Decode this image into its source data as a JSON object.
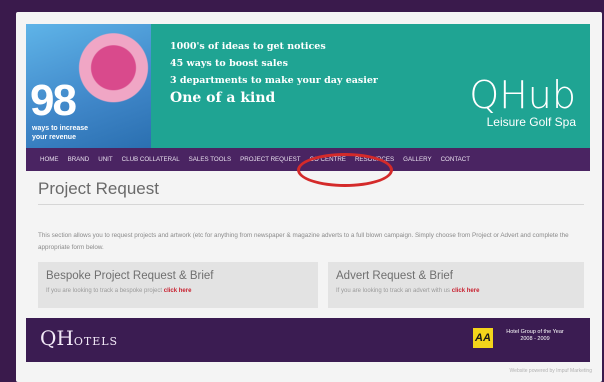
{
  "header": {
    "hero_number": "98",
    "hero_subtitle_line1": "ways to increase",
    "hero_subtitle_line2": "your revenue",
    "line1": "1000's of ideas to get notices",
    "line2": "45 ways to boost sales",
    "line3": "3 departments to make your day easier",
    "line4": "One of a kind",
    "brand_logo": "QHub",
    "brand_subtitle": "Leisure Golf Spa"
  },
  "nav": {
    "items": [
      "HOME",
      "BRAND",
      "UNIT",
      "CLUB COLLATERAL",
      "SALES TOOLS",
      "PROJECT REQUEST",
      "CO CENTRE",
      "RESOURCES",
      "GALLERY",
      "CONTACT"
    ]
  },
  "main": {
    "title": "Project Request",
    "description": "This section allows you to request projects and artwork (etc for anything from newspaper & magazine adverts to a full blown campaign. Simply choose from Project or Advert and complete the appropriate form below.",
    "cards": [
      {
        "title": "Bespoke Project Request & Brief",
        "text": "If you are looking to track a bespoke project",
        "link": "click here"
      },
      {
        "title": "Advert Request & Brief",
        "text": "If you are looking to track an advert with us",
        "link": "click here"
      }
    ]
  },
  "footer": {
    "logo_main": "QH",
    "logo_small": "OTELS",
    "aa_badge": "AA",
    "award_line1": "Hotel Group of the Year",
    "award_line2": "2008 - 2009",
    "credit": "Website powered by Impuf Marketing"
  },
  "colors": {
    "teal": "#1fa493",
    "purple": "#4a2462",
    "highlight": "#d42a2a",
    "link_red": "#c8202f"
  }
}
